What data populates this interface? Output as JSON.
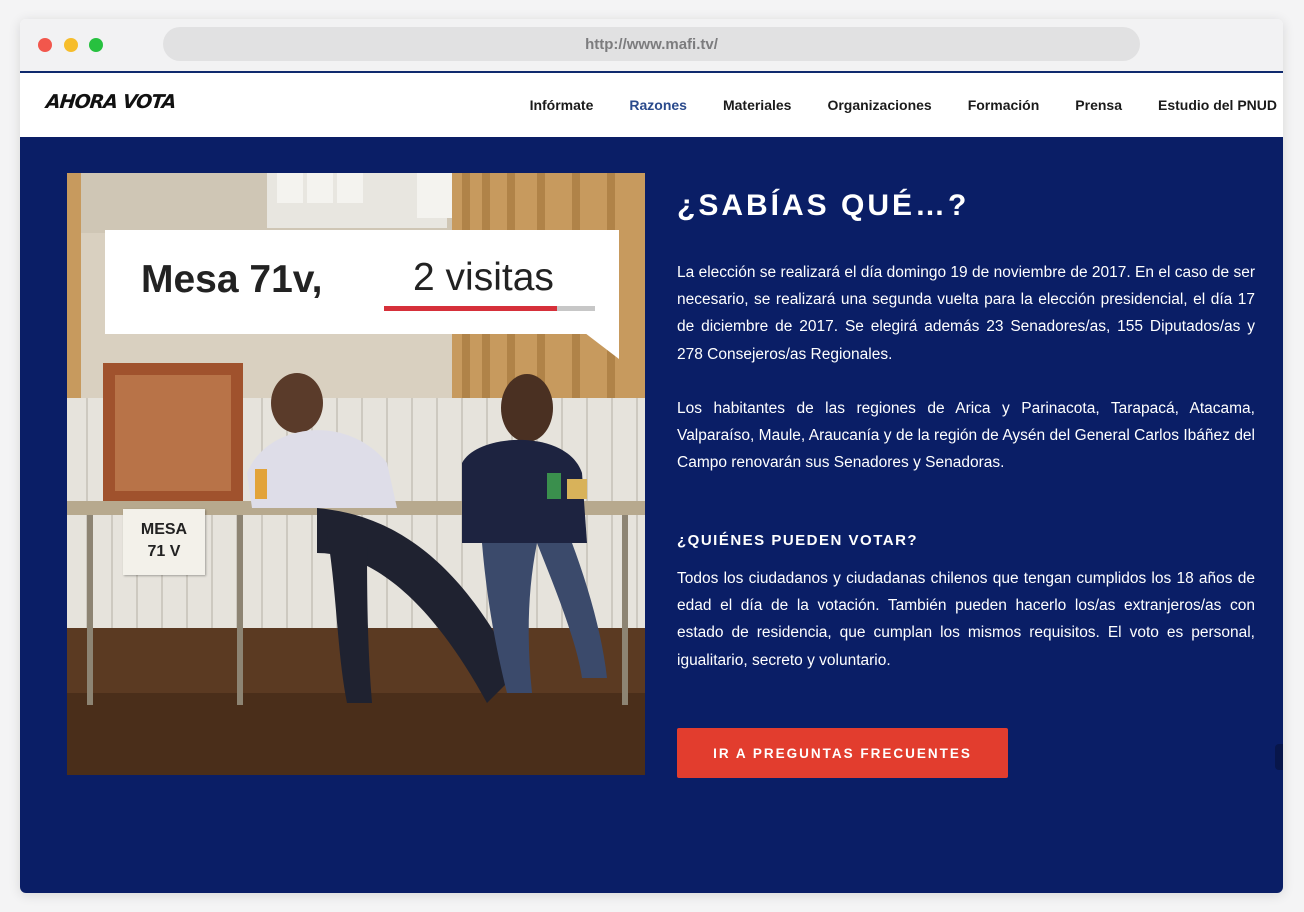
{
  "browser": {
    "url": "http://www.mafi.tv/"
  },
  "site": {
    "logo_text": "AHORA VOTA",
    "nav": [
      {
        "label": "Infórmate",
        "active": false
      },
      {
        "label": "Razones",
        "active": true
      },
      {
        "label": "Materiales",
        "active": false
      },
      {
        "label": "Organizaciones",
        "active": false
      },
      {
        "label": "Formación",
        "active": false
      },
      {
        "label": "Prensa",
        "active": false
      },
      {
        "label": "Estudio del PNUD",
        "active": false
      }
    ]
  },
  "photo": {
    "caption_left": "Mesa 71v,",
    "caption_right": "2 visitas",
    "caption_progress": 0.82,
    "sign_line1": "MESA",
    "sign_line2": "71 V"
  },
  "content": {
    "heading": "¿SABÍAS QUÉ…?",
    "paragraph1": "La elección se realizará el día domingo 19 de noviembre de 2017. En el caso de ser necesario, se realizará una segunda vuelta para la elección presidencial, el día 17 de diciembre de 2017. Se elegirá además 23 Senadores/as, 155 Diputados/as y 278 Consejeros/as Regionales.",
    "paragraph2": "Los habitantes de las regiones de Arica y Parinacota, Tarapacá, Atacama, Valparaíso, Maule, Araucanía y de la región de Aysén del General Carlos Ibáñez del Campo renovarán sus Senadores y Senadoras.",
    "subheading": "¿QUIÉNES PUEDEN VOTAR?",
    "paragraph3": "Todos los ciudadanos y ciudadanas chilenos que tengan cumplidos los 18 años de edad el día de la votación. También pueden hacerlo los/as extranjeros/as con estado de residencia, que cumplan los mismos requisitos. El voto es personal, igualitario, secreto y voluntario.",
    "cta_label": "IR A PREGUNTAS FRECUENTES"
  },
  "colors": {
    "hero_bg": "#0a1e66",
    "cta_bg": "#e23d2e",
    "nav_active": "#2a4a8c"
  }
}
